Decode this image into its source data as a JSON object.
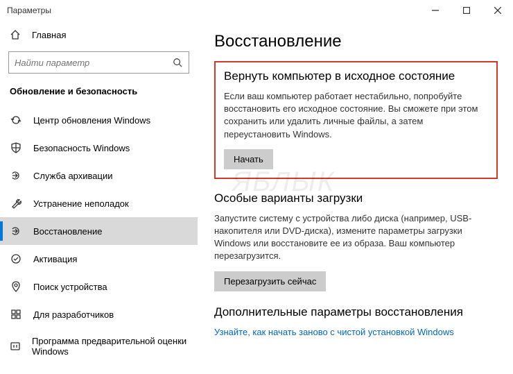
{
  "window": {
    "title": "Параметры"
  },
  "sidebar": {
    "home_label": "Главная",
    "search_placeholder": "Найти параметр",
    "category": "Обновление и безопасность",
    "items": [
      {
        "label": "Центр обновления Windows"
      },
      {
        "label": "Безопасность Windows"
      },
      {
        "label": "Служба архивации"
      },
      {
        "label": "Устранение неполадок"
      },
      {
        "label": "Восстановление"
      },
      {
        "label": "Активация"
      },
      {
        "label": "Поиск устройства"
      },
      {
        "label": "Для разработчиков"
      },
      {
        "label": "Программа предварительной оценки Windows"
      }
    ]
  },
  "main": {
    "page_title": "Восстановление",
    "reset": {
      "title": "Вернуть компьютер в исходное состояние",
      "text": "Если ваш компьютер работает нестабильно, попробуйте восстановить его исходное состояние. Вы сможете при этом сохранить или удалить личные файлы, а затем переустановить Windows.",
      "button": "Начать"
    },
    "advanced_startup": {
      "title": "Особые варианты загрузки",
      "text": "Запустите систему с устройства либо диска (например, USB-накопителя или DVD-диска), измените параметры загрузки Windows или восстановите ее из образа. Ваш компьютер перезагрузится.",
      "button": "Перезагрузить сейчас"
    },
    "more_options": {
      "title": "Дополнительные параметры восстановления",
      "link": "Узнайте, как начать заново с чистой установкой Windows"
    }
  },
  "watermark": "ЯБЛЫК"
}
